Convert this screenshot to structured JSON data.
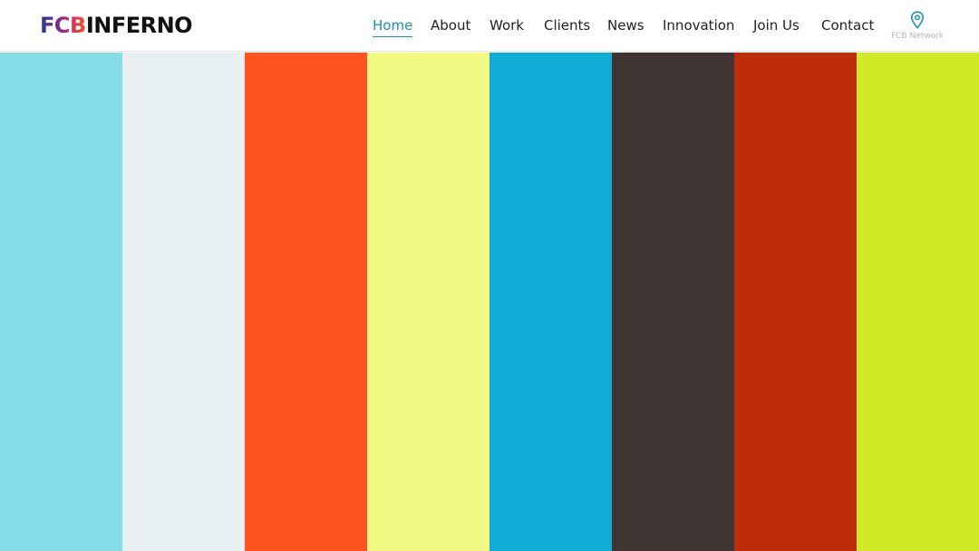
{
  "header": {
    "logo": {
      "part1": "FCB",
      "part2": "INFERNO"
    },
    "nav": [
      {
        "label": "Home",
        "active": true
      },
      {
        "label": "About",
        "active": false
      },
      {
        "label": "Work",
        "active": false
      },
      {
        "label": "Clients",
        "active": false
      },
      {
        "label": "News",
        "active": false
      },
      {
        "label": "Innovation",
        "active": false
      },
      {
        "label": "Join Us",
        "active": false
      },
      {
        "label": "Contact",
        "active": false
      }
    ],
    "network": {
      "label": "FCB Network",
      "icon": "map-pin-icon"
    }
  },
  "colors": {
    "accent": "#1a8fb8",
    "stripes": [
      "#84dce6",
      "#e8f0f3",
      "#ff5422",
      "#f2fa84",
      "#0fadd4",
      "#403532",
      "#bc2d08",
      "#d0eb26"
    ]
  }
}
